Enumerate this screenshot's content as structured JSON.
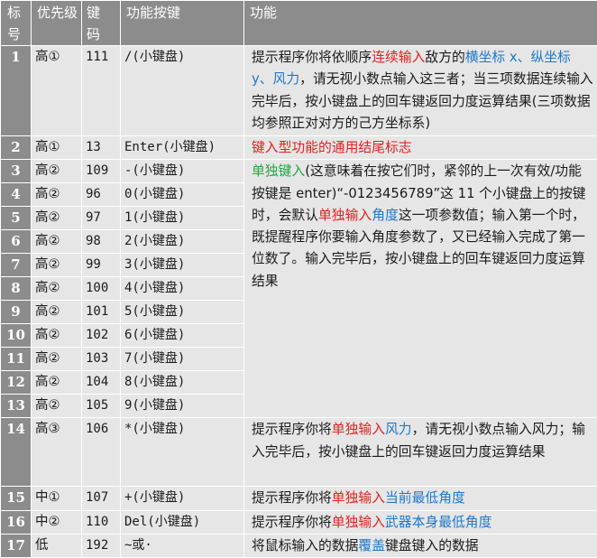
{
  "headers": {
    "num": "标号",
    "priority": "优先级",
    "keycode": "键码",
    "key": "功能按键",
    "func": "功能"
  },
  "rows": [
    {
      "num": "1",
      "priority": "高①",
      "keycode": "111",
      "key": "/(小键盘)"
    },
    {
      "num": "2",
      "priority": "高①",
      "keycode": "13",
      "key": "Enter(小键盘)"
    },
    {
      "num": "3",
      "priority": "高②",
      "keycode": "109",
      "key": "-(小键盘)"
    },
    {
      "num": "4",
      "priority": "高②",
      "keycode": "96",
      "key": "0(小键盘)"
    },
    {
      "num": "5",
      "priority": "高②",
      "keycode": "97",
      "key": "1(小键盘)"
    },
    {
      "num": "6",
      "priority": "高②",
      "keycode": "98",
      "key": "2(小键盘)"
    },
    {
      "num": "7",
      "priority": "高②",
      "keycode": "99",
      "key": "3(小键盘)"
    },
    {
      "num": "8",
      "priority": "高②",
      "keycode": "100",
      "key": "4(小键盘)"
    },
    {
      "num": "9",
      "priority": "高②",
      "keycode": "101",
      "key": "5(小键盘)"
    },
    {
      "num": "10",
      "priority": "高②",
      "keycode": "102",
      "key": "6(小键盘)"
    },
    {
      "num": "11",
      "priority": "高②",
      "keycode": "103",
      "key": "7(小键盘)"
    },
    {
      "num": "12",
      "priority": "高②",
      "keycode": "104",
      "key": "8(小键盘)"
    },
    {
      "num": "13",
      "priority": "高②",
      "keycode": "105",
      "key": "9(小键盘)"
    },
    {
      "num": "14",
      "priority": "高③",
      "keycode": "106",
      "key": "*(小键盘)"
    },
    {
      "num": "15",
      "priority": "中①",
      "keycode": "107",
      "key": "+(小键盘)"
    },
    {
      "num": "16",
      "priority": "中②",
      "keycode": "110",
      "key": "Del(小键盘)"
    },
    {
      "num": "17",
      "priority": "低",
      "keycode": "192",
      "key": "~或·"
    }
  ],
  "descriptions": {
    "d1": {
      "a": "提示程序你将依顺序",
      "b": "连续输入",
      "c": "敌方的",
      "d": "横坐标 x、纵坐标 y、风力",
      "e": "，请无视小数点输入这三者；当三项数据连续输入完毕后，按小键盘上的回车键返回力度运算结果(三项数据均参照正对对方的己方坐标系)"
    },
    "d2": {
      "a": "键入型功能的通用结尾标志"
    },
    "d3": {
      "a": "单独键入",
      "b": "(这意味着在按它们时，紧邻的上一次有效/功能按键是 enter)“-0123456789”这 11 个小键盘上的按键时，会默认",
      "c": "单独输入",
      "d": "角度",
      "e": "这一项参数值；输入第一个时，既提醒程序你要输入角度参数了，又已经输入完成了第一位数了。输入完毕后，按小键盘上的回车键返回力度运算结果"
    },
    "d14": {
      "a": "提示程序你将",
      "b": "单独输入",
      "c": "风力",
      "d": "，请无视小数点输入风力；输入完毕后，按小键盘上的回车键返回力度运算结果"
    },
    "d15": {
      "a": "提示程序你将",
      "b": "单独输入",
      "c": "当前最低角度"
    },
    "d16": {
      "a": "提示程序你将",
      "b": "单独输入",
      "c": "武器本身最低角度"
    },
    "d17": {
      "a": "将鼠标输入的数据",
      "b": "覆盖",
      "c": "键盘键入的数据"
    }
  },
  "colors": {
    "header_bg": "#8c8c8c",
    "cell_bg": "#e6e6e6",
    "highlight_red": "#e02020",
    "highlight_blue": "#1f77c8",
    "highlight_green": "#1fa842"
  }
}
